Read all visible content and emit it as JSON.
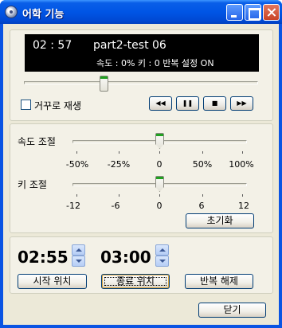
{
  "window": {
    "title": "어학 기능"
  },
  "display": {
    "time": "02 : 57",
    "track": "part2-test 06",
    "status": "속도 : 0%  키 : 0   반복 설정 ON"
  },
  "playback": {
    "reverse_label": "거꾸로 재생",
    "reverse_checked": false,
    "rewind_icon": "◀◀",
    "pause_icon": "❚❚",
    "stop_icon": "■",
    "forward_icon": "▶▶",
    "position_fraction": 0.34
  },
  "speed": {
    "label": "속도 조절",
    "value": "0%",
    "ticks": [
      "-50%",
      "-25%",
      "0",
      "50%",
      "100%"
    ]
  },
  "key": {
    "label": "키 조절",
    "value": 0,
    "ticks": [
      "-12",
      "-6",
      "0",
      "6",
      "12"
    ],
    "reset_label": "초기화"
  },
  "repeat": {
    "start_time": "02:55",
    "end_time": "03:00",
    "start_label": "시작 위치",
    "end_label": "종료 위치",
    "clear_label": "반복 해제"
  },
  "footer": {
    "close_label": "닫기"
  },
  "colors": {
    "titlebar": "#0054e3",
    "accent_thumb": "#21a121"
  }
}
